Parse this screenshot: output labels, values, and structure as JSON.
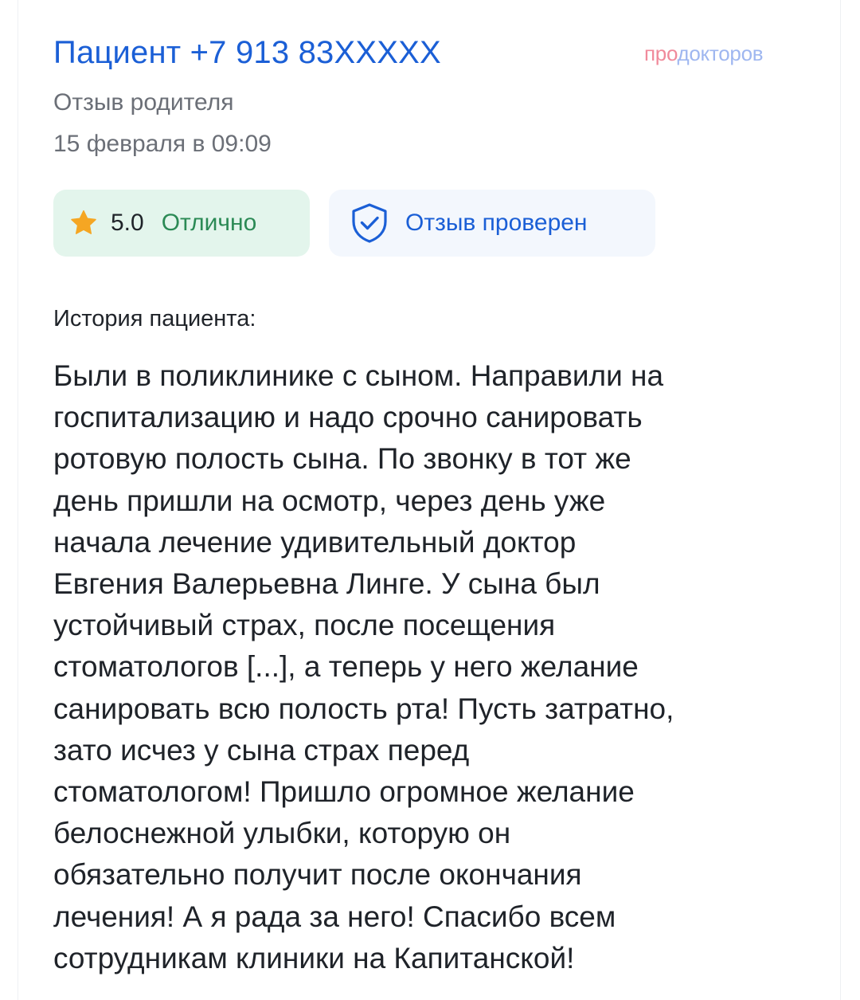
{
  "review": {
    "author": "Пациент +7 913 83XXXXX",
    "brand": {
      "part1": "про",
      "part2": "докторов",
      "color_part1": "#f08a9b",
      "color_part2": "#9fb7f0"
    },
    "type": "Отзыв родителя",
    "date": "15 февраля в 09:09",
    "rating": {
      "value": "5.0",
      "label": "Отлично",
      "icon": "star-icon",
      "color": "#2b8a55"
    },
    "verified": {
      "label": "Отзыв проверен",
      "icon": "shield-check-icon",
      "color": "#1b5fd6"
    },
    "history_title": "История пациента:",
    "text": "Были в поликлинике с сыном. Направили на\nгоспитализацию и надо срочно санировать\nротовую полость сына. По звонку в тот же\nдень пришли на осмотр, через день уже\nначала лечение удивительный доктор\nЕвгения Валерьевна Линге. У сына был\nустойчивый страх, после посещения\nстоматологов [...], а теперь у него желание\nсанировать всю полость рта! Пусть затратно,\nзато исчез у сына страх перед\nстоматологом! Пришло огромное желание\nбелоснежной улыбки, которую он\nобязательно получит после окончания\nлечения! А я рада за него! Спасибо всем\nсотрудникам клиники на Капитанской!"
  }
}
